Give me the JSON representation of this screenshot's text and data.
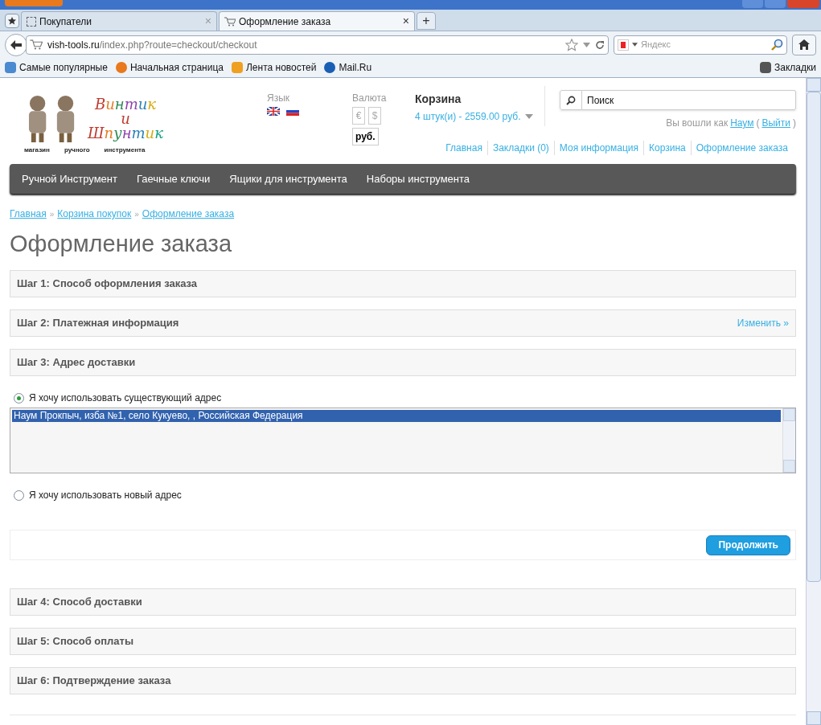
{
  "browser": {
    "tabs": [
      {
        "label": "Покупатели",
        "selected": false,
        "close": "×"
      },
      {
        "label": "Оформление заказа",
        "selected": true,
        "close": "×"
      }
    ],
    "new_tab": "+",
    "url_host": "vish-tools.ru",
    "url_path": "/index.php?route=checkout/checkout",
    "search_placeholder": "Яндекс",
    "bookmarks": [
      "Самые популярные",
      "Начальная страница",
      "Лента новостей",
      "Mail.Ru"
    ],
    "bookmarks_menu": "Закладки"
  },
  "logo": {
    "title_1": "Винтик",
    "title_2": "и",
    "title_3": "Шпунтик",
    "tagline": [
      "магазин",
      "ручного",
      "инструмента"
    ]
  },
  "language": {
    "label": "Язык"
  },
  "currency": {
    "label": "Валюта",
    "options": [
      {
        "label": "€",
        "selected": false
      },
      {
        "label": "$",
        "selected": false
      },
      {
        "label": "руб.",
        "selected": true
      }
    ]
  },
  "cart": {
    "title": "Корзина",
    "summary": "4 штук(и) - 2559.00 руб."
  },
  "search": {
    "placeholder": "Поиск"
  },
  "login": {
    "prefix": "Вы вошли как",
    "user": "Наум",
    "open": "(",
    "logout": "Выйти",
    "close": ")"
  },
  "top_links": [
    "Главная",
    "Закладки (0)",
    "Моя информация",
    "Корзина",
    "Оформление заказа"
  ],
  "menu": [
    "Ручной Инструмент",
    "Гаечные ключи",
    "Ящики для инструмента",
    "Наборы инструмента"
  ],
  "breadcrumbs": [
    "Главная",
    "Корзина покупок",
    "Оформление заказа"
  ],
  "breadcrumb_separator": "»",
  "heading": "Оформление заказа",
  "steps_before": [
    {
      "title": "Шаг 1: Способ оформления заказа"
    },
    {
      "title": "Шаг 2: Платежная информация",
      "action": "Изменить »"
    },
    {
      "title": "Шаг 3: Адрес доставки"
    }
  ],
  "address": {
    "options": [
      {
        "label": "Я хочу использовать существующий адрес",
        "selected": true
      },
      {
        "label": "Я хочу использовать новый адрес",
        "selected": false
      }
    ],
    "addresses": [
      {
        "text": "Наум Прокпыч, изба №1, село Кукуево, , Российская Федерация",
        "selected": true
      }
    ],
    "continue": "Продолжить"
  },
  "steps_after": [
    {
      "title": "Шаг 4: Способ доставки"
    },
    {
      "title": "Шаг 5: Способ оплаты"
    },
    {
      "title": "Шаг 6: Подтверждение заказа"
    }
  ]
}
